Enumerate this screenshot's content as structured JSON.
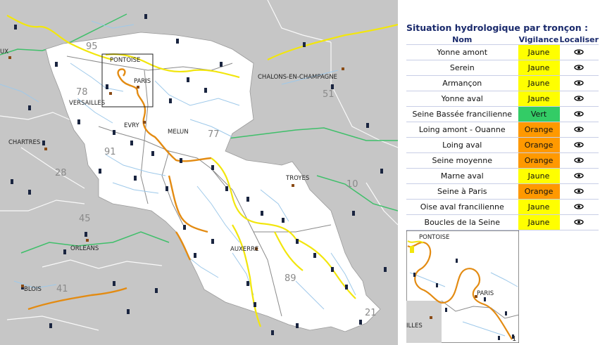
{
  "panel": {
    "title": "Situation hydrologique par tronçon :",
    "headers": {
      "name": "Nom",
      "level": "Vigilance",
      "locate": "Localiser"
    },
    "rows": [
      {
        "name": "Yonne amont",
        "level": "Jaune",
        "color": "#ffff00"
      },
      {
        "name": "Serein",
        "level": "Jaune",
        "color": "#ffff00"
      },
      {
        "name": "Armançon",
        "level": "Jaune",
        "color": "#ffff00"
      },
      {
        "name": "Yonne aval",
        "level": "Jaune",
        "color": "#ffff00"
      },
      {
        "name": "Seine Bassée francilienne",
        "level": "Vert",
        "color": "#33cc66"
      },
      {
        "name": "Loing amont - Ouanne",
        "level": "Orange",
        "color": "#ff9900"
      },
      {
        "name": "Loing aval",
        "level": "Orange",
        "color": "#ff9900"
      },
      {
        "name": "Seine moyenne",
        "level": "Orange",
        "color": "#ff9900"
      },
      {
        "name": "Marne aval",
        "level": "Jaune",
        "color": "#ffff00"
      },
      {
        "name": "Seine à Paris",
        "level": "Orange",
        "color": "#ff9900"
      },
      {
        "name": "Oise aval francilienne",
        "level": "Jaune",
        "color": "#ffff00"
      },
      {
        "name": "Boucles de la Seine",
        "level": "Jaune",
        "color": "#ffff00"
      }
    ],
    "locate_icon": "eye-icon"
  },
  "map": {
    "cities": {
      "pontoise": "PONTOISE",
      "paris": "PARIS",
      "versailles": "VERSAILLES",
      "chalons": "CHALONS-EN-CHAMPAGNE",
      "evry": "EVRY",
      "melun": "MELUN",
      "chartres": "CHARTRES",
      "troyes": "TROYES",
      "orleans": "ORLEANS",
      "auxerre": "AUXERRE",
      "blois": "BLOIS",
      "ux": "UX"
    },
    "departments": {
      "d95": "95",
      "d78": "78",
      "d91": "91",
      "d77": "77",
      "d51": "51",
      "d28": "28",
      "d10": "10",
      "d45": "45",
      "d89": "89",
      "d41": "41",
      "d21": "21"
    }
  },
  "inset": {
    "cities": {
      "pontoise": "PONTOISE",
      "paris": "PARIS",
      "illes": "ILLES"
    },
    "page": "1"
  }
}
